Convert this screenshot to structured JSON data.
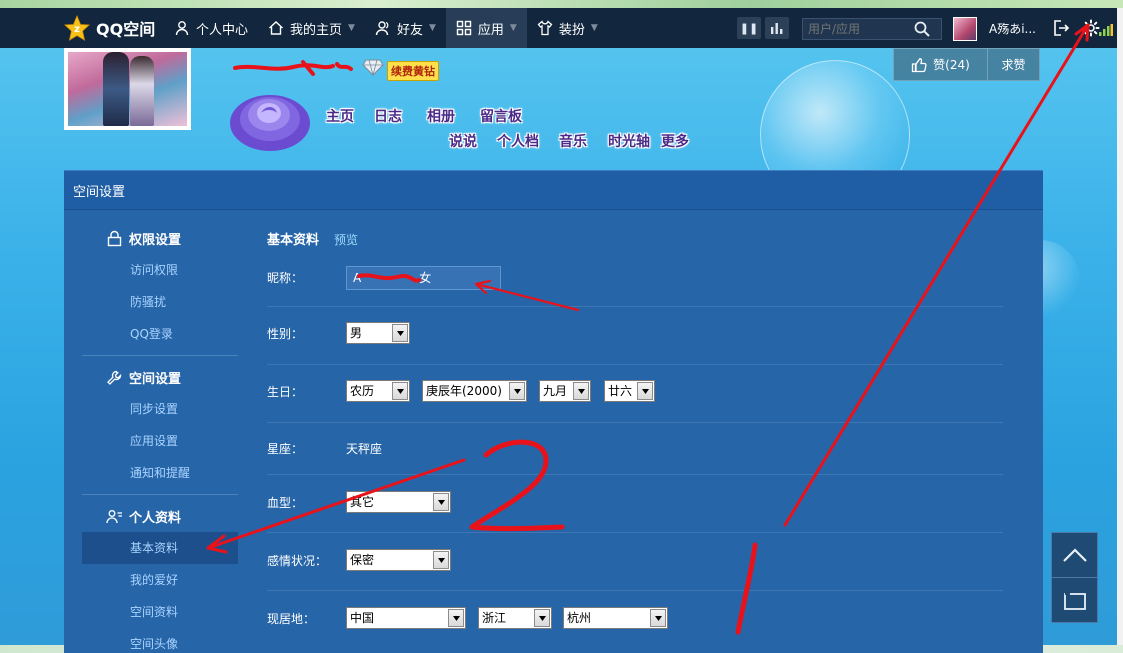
{
  "topnav": {
    "logo_text": "QQ空间",
    "items": [
      {
        "label": "个人中心",
        "icon": "person-icon"
      },
      {
        "label": "我的主页",
        "icon": "home-icon"
      },
      {
        "label": "好友",
        "icon": "friends-icon"
      },
      {
        "label": "应用",
        "icon": "apps-icon"
      },
      {
        "label": "装扮",
        "icon": "dress-up-icon"
      }
    ],
    "search_placeholder": "用户/应用",
    "user_name": "A殇あi...",
    "colors": {
      "bar": "#12263d",
      "active": "#283e58"
    }
  },
  "likebar": {
    "like_label": "赞(24)",
    "ask_label": "求赞"
  },
  "header": {
    "renew_badge": "续费黄钻",
    "tabs_row1": [
      "主页",
      "日志",
      "相册",
      "留言板"
    ],
    "tabs_row2": [
      "说说",
      "个人档",
      "音乐",
      "时光轴",
      "更多"
    ]
  },
  "panel": {
    "title": "空间设置",
    "sidebar": [
      {
        "title": "权限设置",
        "icon": "lock-icon",
        "links": [
          "访问权限",
          "防骚扰",
          "QQ登录"
        ]
      },
      {
        "title": "空间设置",
        "icon": "wrench-icon",
        "links": [
          "同步设置",
          "应用设置",
          "通知和提醒"
        ]
      },
      {
        "title": "个人资料",
        "icon": "profile-card-icon",
        "links": [
          "基本资料",
          "我的爱好",
          "空间资料",
          "空间头像"
        ]
      }
    ],
    "active_link": "基本资料",
    "content": {
      "title": "基本资料",
      "preview": "预览",
      "nickname_label": "昵称：",
      "nickname_value": "A",
      "nickname_suffix": "女",
      "gender_label": "性别：",
      "gender_value": "男",
      "birthday_label": "生日：",
      "birthday_calendar": "农历",
      "birthday_year": "庚辰年(2000)",
      "birthday_month": "九月",
      "birthday_day": "廿六",
      "zodiac_label": "星座：",
      "zodiac_value": "天秤座",
      "blood_label": "血型：",
      "blood_value": "其它",
      "relationship_label": "感情状况：",
      "relationship_value": "保密",
      "residence_label": "现居地：",
      "residence_country": "中国",
      "residence_province": "浙江",
      "residence_city": "杭州"
    }
  },
  "annotation_color": "#e8131a"
}
